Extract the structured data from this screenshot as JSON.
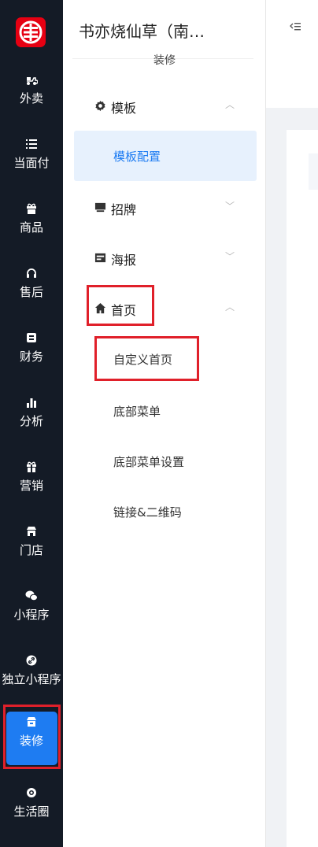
{
  "nav": {
    "items": [
      {
        "label": "外卖",
        "icon": "scooter-icon"
      },
      {
        "label": "当面付",
        "icon": "list-icon"
      },
      {
        "label": "商品",
        "icon": "gift-box-icon"
      },
      {
        "label": "售后",
        "icon": "headset-icon"
      },
      {
        "label": "财务",
        "icon": "wallet-icon"
      },
      {
        "label": "分析",
        "icon": "bar-chart-icon"
      },
      {
        "label": "营销",
        "icon": "gift-icon"
      },
      {
        "label": "门店",
        "icon": "store-icon"
      },
      {
        "label": "小程序",
        "icon": "wechat-icon"
      },
      {
        "label": "独立小程序",
        "icon": "link-icon"
      },
      {
        "label": "装修",
        "icon": "shop-decor-icon"
      },
      {
        "label": "生活圈",
        "icon": "life-circle-icon"
      }
    ],
    "active": "装修"
  },
  "panel": {
    "store_name": "书亦烧仙草（南…",
    "section_label": "装修",
    "groups": [
      {
        "label": "模板",
        "icon": "gear-icon",
        "expanded": true,
        "children": [
          "模板配置"
        ]
      },
      {
        "label": "招牌",
        "icon": "signboard-icon",
        "expanded": false
      },
      {
        "label": "海报",
        "icon": "poster-icon",
        "expanded": false
      },
      {
        "label": "首页",
        "icon": "home-icon",
        "expanded": true,
        "children": [
          "自定义首页",
          "底部菜单",
          "底部菜单设置",
          "链接&二维码"
        ]
      }
    ],
    "selected": "模板配置"
  },
  "colors": {
    "nav_bg": "#141b26",
    "active_blue": "#1e7cf2",
    "selected_text": "#1e7cf2",
    "highlight_red": "#e0202a"
  }
}
